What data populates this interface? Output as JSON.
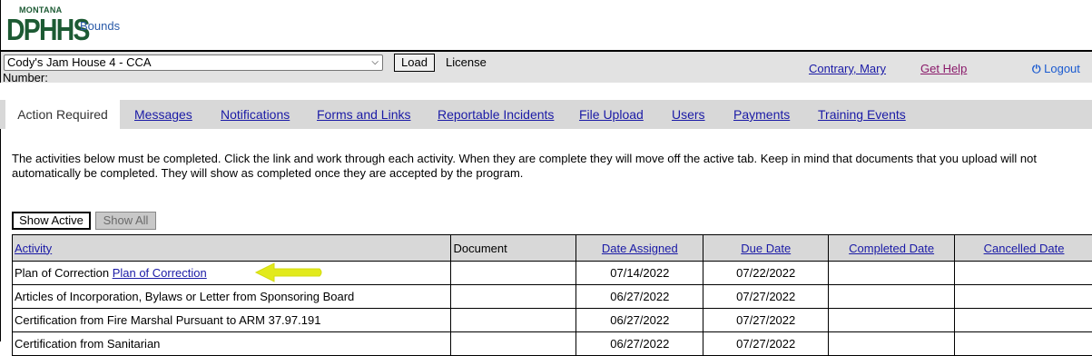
{
  "header": {
    "logo_top": "MONTANA",
    "logo_main": "DPHHS",
    "app_name": "Bounds"
  },
  "toolbar": {
    "facility_selected": "Cody's Jam House 4 - CCA",
    "load_label": "Load",
    "license_label": "License",
    "number_label": "Number:",
    "user_name": "Contrary, Mary",
    "help_label": "Get Help",
    "logout_label": "Logout"
  },
  "tabs": [
    {
      "label": "Action Required",
      "active": true
    },
    {
      "label": "Messages"
    },
    {
      "label": "Notifications"
    },
    {
      "label": "Forms and Links"
    },
    {
      "label": "Reportable Incidents"
    },
    {
      "label": "File Upload"
    },
    {
      "label": "Users"
    },
    {
      "label": "Payments"
    },
    {
      "label": "Training Events"
    }
  ],
  "intro": "The activities below must be completed. Click the link and work through each activity. When they are complete they will move off the active tab. Keep in mind that documents that you upload will not automatically be completed. They will show as completed once they are accepted by the program.",
  "filters": {
    "show_active": "Show Active",
    "show_all": "Show All"
  },
  "table": {
    "headers": {
      "activity": "Activity",
      "document": "Document",
      "date_assigned": "Date Assigned",
      "due_date": "Due Date",
      "completed_date": "Completed Date",
      "cancelled_date": "Cancelled Date"
    },
    "rows": [
      {
        "activity": "Plan of Correction",
        "activity_link": "Plan of Correction",
        "document": "",
        "date_assigned": "07/14/2022",
        "due_date": "07/22/2022",
        "completed_date": "",
        "cancelled_date": ""
      },
      {
        "activity": "Articles of Incorporation, Bylaws or Letter from Sponsoring Board",
        "activity_link": "",
        "document": "",
        "date_assigned": "06/27/2022",
        "due_date": "07/27/2022",
        "completed_date": "",
        "cancelled_date": ""
      },
      {
        "activity": "Certification from Fire Marshal Pursuant to ARM 37.97.191",
        "activity_link": "",
        "document": "",
        "date_assigned": "06/27/2022",
        "due_date": "07/27/2022",
        "completed_date": "",
        "cancelled_date": ""
      },
      {
        "activity": "Certification from Sanitarian",
        "activity_link": "",
        "document": "",
        "date_assigned": "06/27/2022",
        "due_date": "07/27/2022",
        "completed_date": "",
        "cancelled_date": ""
      }
    ]
  },
  "colors": {
    "logo_green": "#1c5a33",
    "link_blue": "#1a1aa6",
    "help_purple": "#8a1a6a",
    "arrow_yellow": "#e2ea1c",
    "tab_bar_gray": "#d8d8d8"
  },
  "icons": {
    "logout": "power-icon",
    "annotation": "arrow-left-icon"
  }
}
